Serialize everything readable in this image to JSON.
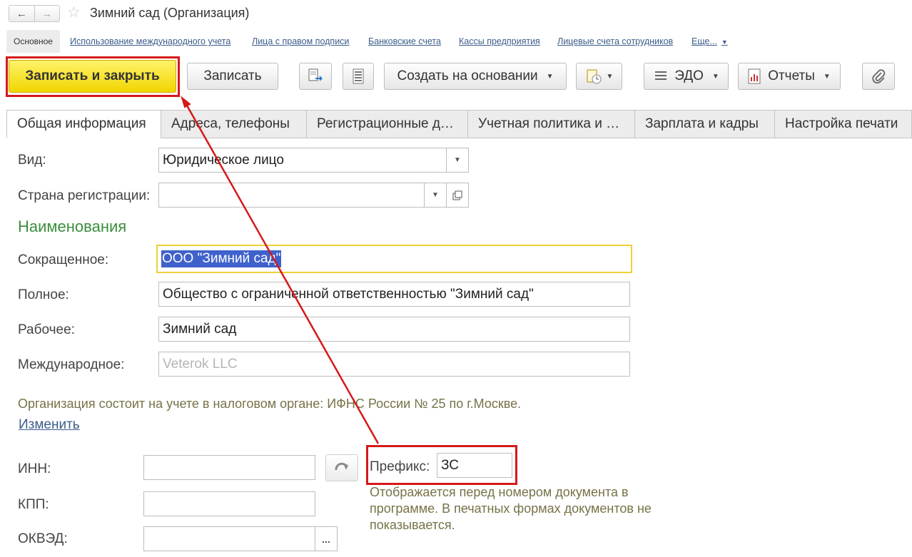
{
  "window": {
    "title": "Зимний сад (Организация)",
    "back_icon": "←",
    "forward_icon": "→",
    "star_icon": "☆"
  },
  "links": {
    "active": "Основное",
    "items": [
      "Использование международного учета",
      "Лица с правом подписи",
      "Банковские счета",
      "Кассы предприятия",
      "Лицевые счета сотрудников",
      "Еще..."
    ],
    "more_arrow": "▼"
  },
  "toolbar": {
    "save_close": "Записать и закрыть",
    "save": "Записать",
    "create_based": "Создать на основании",
    "edo": "ЭДО",
    "reports": "Отчеты",
    "caret": "▼"
  },
  "tabs": [
    "Общая информация",
    "Адреса, телефоны",
    "Регистрационные д…",
    "Учетная политика и …",
    "Зарплата и кадры",
    "Настройка печати"
  ],
  "form": {
    "type_label": "Вид:",
    "type_value": "Юридическое лицо",
    "country_label": "Страна регистрации:",
    "country_value": "",
    "names_heading": "Наименования",
    "short_label": "Сокращенное:",
    "short_value": "ООО \"Зимний сад\"",
    "full_label": "Полное:",
    "full_value": "Общество с ограниченной ответственностью \"Зимний сад\"",
    "working_label": "Рабочее:",
    "working_value": "Зимний сад",
    "intl_label": "Международное:",
    "intl_placeholder": "Veterok LLC",
    "tax_note": "Организация состоит на учете в налоговом органе: ИФНС России № 25 по г.Москве.",
    "change_link": "Изменить",
    "inn_label": "ИНН:",
    "kpp_label": "КПП:",
    "okved_label": "ОКВЭД:",
    "okved_btn": "...",
    "prefix_label": "Префикс:",
    "prefix_value": "ЗС",
    "prefix_note_1": "Отображается перед номером документа в",
    "prefix_note_2": "программе. В печатных формах документов не",
    "prefix_note_3": "показывается."
  },
  "colors": {
    "annotation_red": "#d51919",
    "primary_yellow": "#f6e012",
    "heading_green": "#3c8e3c",
    "link_blue": "#3c5d8c",
    "note_olive": "#787248",
    "selection_blue": "#3f61cc"
  }
}
